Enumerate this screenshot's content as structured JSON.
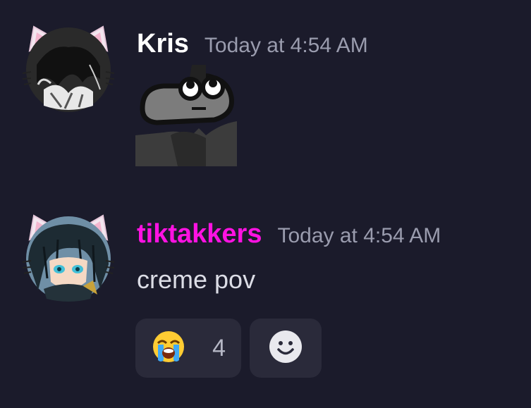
{
  "messages": [
    {
      "username": "Kris",
      "timestamp": "Today at 4:54 AM",
      "username_color": "#ffffff",
      "attachment": "sticker-gray-frog"
    },
    {
      "username": "tiktakkers",
      "timestamp": "Today at 4:54 AM",
      "username_color": "#ff12e2",
      "content": "creme pov",
      "reactions": [
        {
          "emoji": "😭",
          "count": "4"
        }
      ],
      "add_reaction_icon": "smiley-add-reaction-icon"
    }
  ]
}
